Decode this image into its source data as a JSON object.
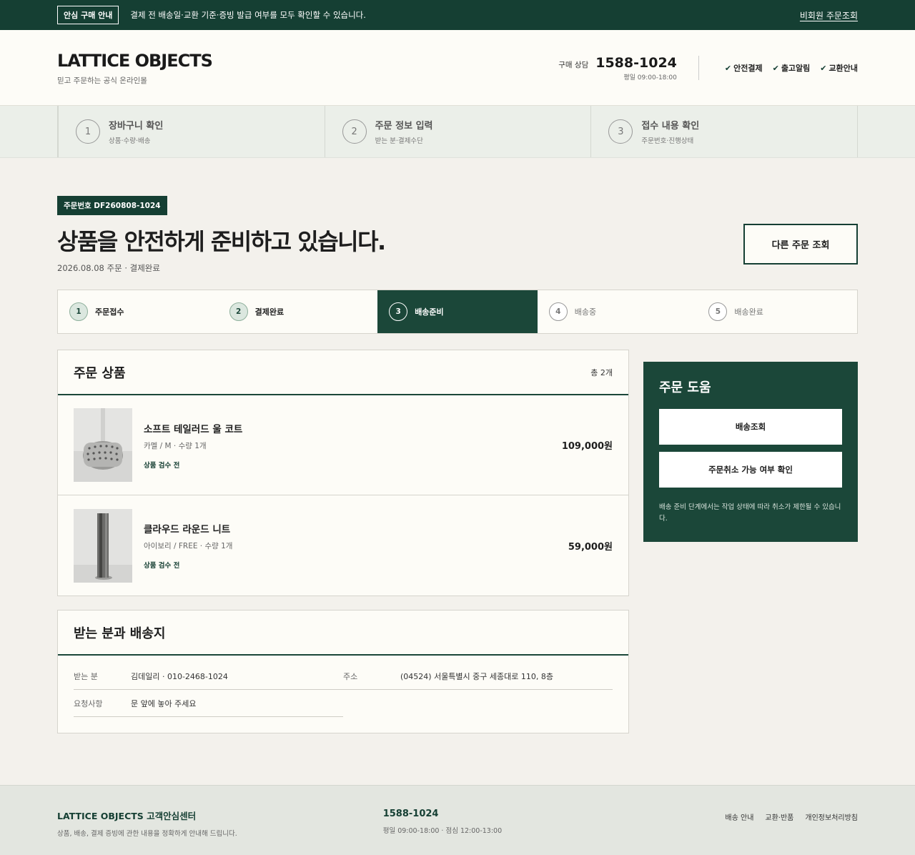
{
  "topbar": {
    "badge": "안심 구매 안내",
    "notice": "결제 전 배송일·교환 기준·증빙 발급 여부를 모두 확인할 수 있습니다.",
    "guest_link": "비회원 주문조회"
  },
  "header": {
    "logo": "LATTICE OBJECTS",
    "logo_sub": "믿고 주문하는 공식 온라인몰",
    "contact_label": "구매 상담",
    "contact_number": "1588-1024",
    "contact_hours": "평일 09:00-18:00",
    "checks": [
      "안전결제",
      "출고알림",
      "교환안내"
    ]
  },
  "checkout_steps": [
    {
      "num": "1",
      "title": "장바구니 확인",
      "sub": "상품·수량·배송"
    },
    {
      "num": "2",
      "title": "주문 정보 입력",
      "sub": "받는 분·결제수단"
    },
    {
      "num": "3",
      "title": "접수 내용 확인",
      "sub": "주문번호·진행상태"
    }
  ],
  "order": {
    "badge": "주문번호 DF260808-1024",
    "headline": "상품을 안전하게 준비하고 있습니다.",
    "sub": "2026.08.08 주문 · 결제완료",
    "other_button": "다른 주문 조회"
  },
  "progress": [
    {
      "num": "1",
      "label": "주문접수",
      "state": "done"
    },
    {
      "num": "2",
      "label": "결제완료",
      "state": "done"
    },
    {
      "num": "3",
      "label": "배송준비",
      "state": "active"
    },
    {
      "num": "4",
      "label": "배송중",
      "state": "todo"
    },
    {
      "num": "5",
      "label": "배송완료",
      "state": "todo"
    }
  ],
  "items_card": {
    "title": "주문 상품",
    "count": "총 2개",
    "items": [
      {
        "name": "소프트 테일러드 울 코트",
        "option": "카멜 / M · 수량 1개",
        "status": "상품 검수 전",
        "price": "109,000원"
      },
      {
        "name": "클라우드 라운드 니트",
        "option": "아이보리 / FREE · 수량 1개",
        "status": "상품 검수 전",
        "price": "59,000원"
      }
    ]
  },
  "shipping": {
    "title": "받는 분과 배송지",
    "receiver_label": "받는 분",
    "receiver_value": "김데일리 · 010-2468-1024",
    "address_label": "주소",
    "address_value": "(04524) 서울특별시 중구 세종대로 110, 8층",
    "request_label": "요청사항",
    "request_value": "문 앞에 놓아 주세요"
  },
  "help": {
    "title": "주문 도움",
    "track_button": "배송조회",
    "cancel_button": "주문취소 가능 여부 확인",
    "note": "배송 준비 단계에서는 작업 상태에 따라 취소가 제한될 수 있습니다."
  },
  "footer": {
    "title": "LATTICE OBJECTS 고객안심센터",
    "sub": "상품, 배송, 결제 증빙에 관한 내용을 정확하게 안내해 드립니다.",
    "number": "1588-1024",
    "hours": "평일 09:00-18:00 · 점심 12:00-13:00",
    "links": [
      "배송 안내",
      "교환·반품",
      "개인정보처리방침"
    ]
  },
  "colors": {
    "brand": "#153f33",
    "background": "#f3f1ec",
    "card": "#fdfcf7"
  }
}
